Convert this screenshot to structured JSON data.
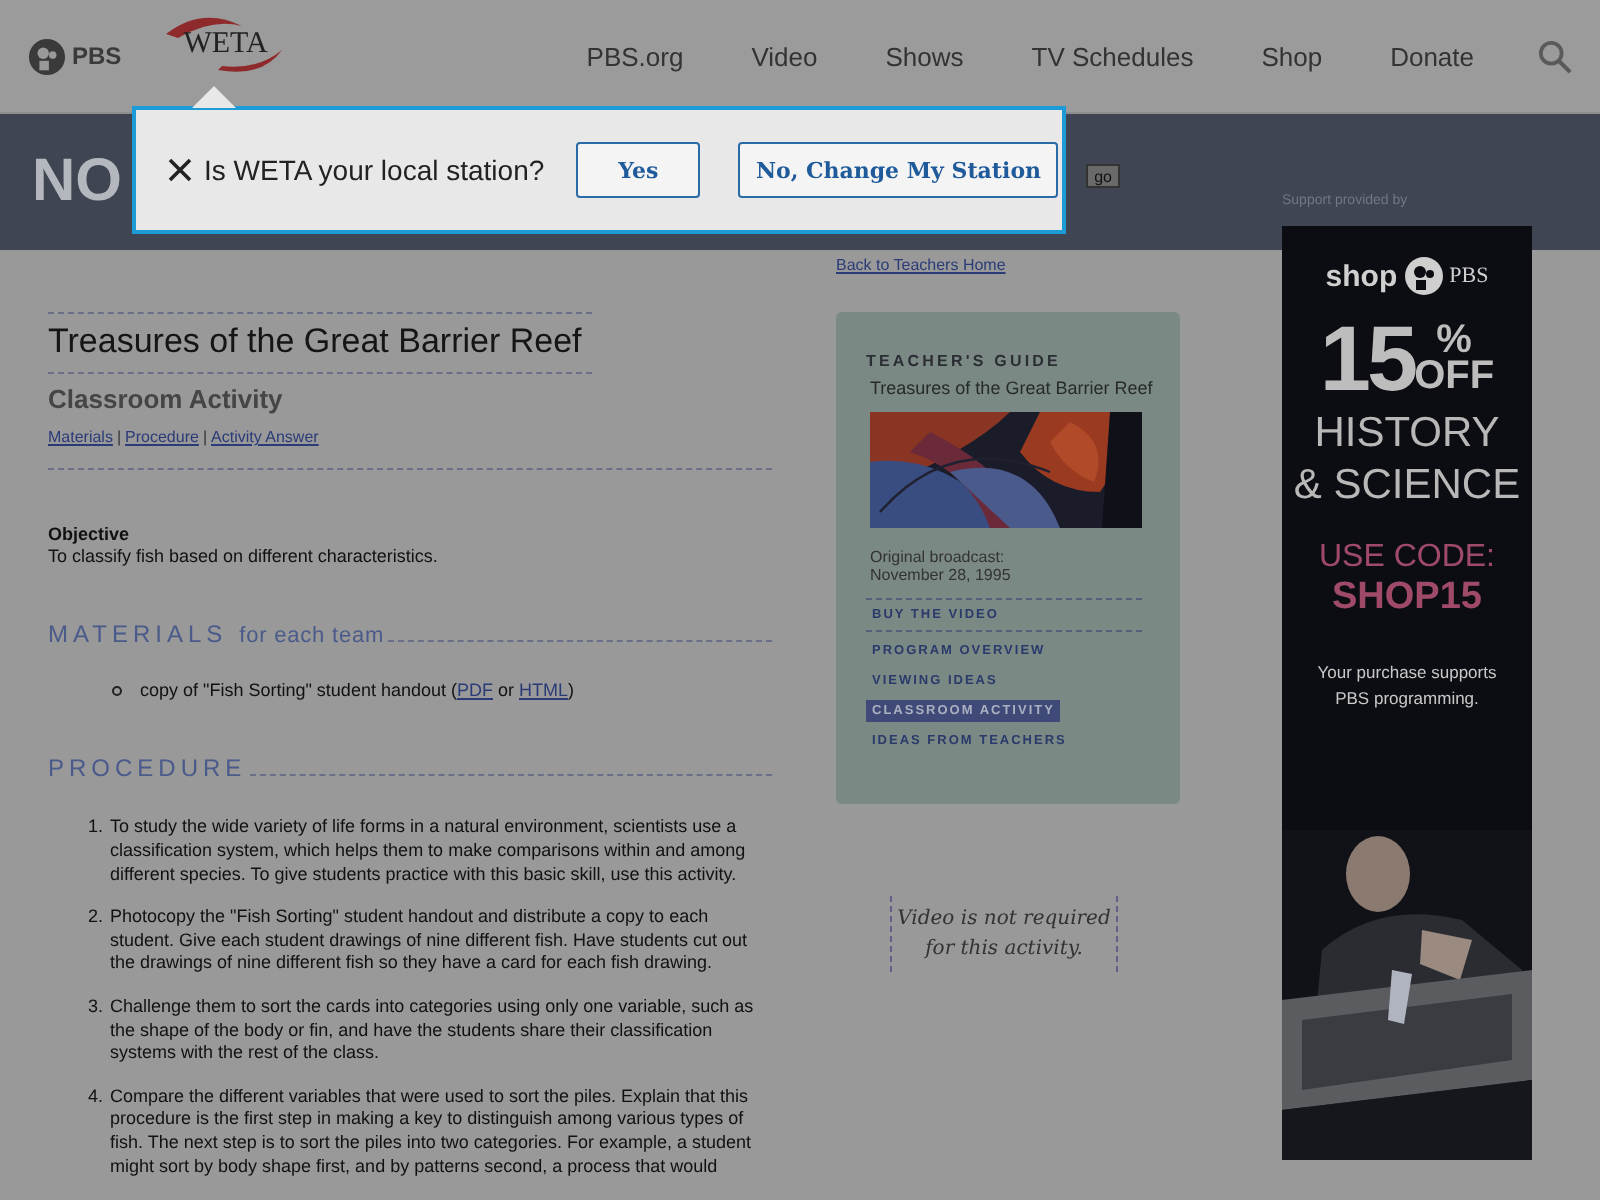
{
  "header": {
    "pbs_logo": "PBS",
    "station_logo": "WETA",
    "nav": [
      "PBS.org",
      "Video",
      "Shows",
      "TV Schedules",
      "Shop",
      "Donate"
    ]
  },
  "station_prompt": {
    "question": "Is WETA your local station?",
    "buttons": [
      "Yes",
      "No, Change My Station"
    ]
  },
  "banner": {
    "logo_main": "NO",
    "go_button": "go",
    "support_label": "Support provided by"
  },
  "article": {
    "title": "Treasures of the Great Barrier Reef",
    "subtitle": "Classroom Activity",
    "separator": "|",
    "links": [
      "Materials",
      "Procedure",
      "Activity Answer"
    ],
    "objective_label": "Objective",
    "objective_text": "To classify fish based on different characteristics.",
    "materials_heading": "MATERIALS",
    "materials_heading_sub": "for each team",
    "materials": [
      {
        "text": "copy of \"Fish Sorting\" student handout (",
        "links": [
          "PDF",
          "HTML"
        ],
        "joiner": "or",
        "close": ")"
      }
    ],
    "procedure_heading": "PROCEDURE",
    "steps": [
      {
        "number": "1.",
        "text": "To study the wide variety of life forms in a natural environment, scientists use a classification system, which helps them to make comparisons within and among different species. To give students practice with this basic skill, use this activity."
      },
      {
        "number": "2.",
        "text": "Photocopy the \"Fish Sorting\" student handout and distribute a copy to each student. Give each student drawings of nine different fish. Have students cut out the drawings of nine different fish so they have a card for each fish drawing."
      },
      {
        "number": "3.",
        "text": "Challenge them to sort the cards into categories using only one variable, such as the shape of the body or fin, and have the students share their classification systems with the rest of the class."
      },
      {
        "number": "4.",
        "text": "Compare the different variables that were used to sort the piles. Explain that this procedure is the first step in making a key to distinguish among various types of fish. The next step is to sort the piles into two categories. For example, a student might sort by body shape first, and by patterns second, a process that would"
      }
    ]
  },
  "sidebar": {
    "back_link": "Back to Teachers Home",
    "guide_heading": "TEACHER'S GUIDE",
    "guide_title": "Treasures of the Great Barrier Reef",
    "broadcast_label": "Original broadcast:",
    "broadcast_date": "November 28, 1995",
    "links": [
      {
        "label": "BUY THE VIDEO",
        "selected": false
      },
      {
        "label": "PROGRAM OVERVIEW",
        "selected": false
      },
      {
        "label": "VIEWING IDEAS",
        "selected": false
      },
      {
        "label": "CLASSROOM ACTIVITY",
        "selected": true
      },
      {
        "label": "IDEAS FROM TEACHERS",
        "selected": false
      }
    ],
    "note": "Video is not required for this activity."
  },
  "ad": {
    "brand_left": "shop",
    "brand_right": "PBS",
    "discount": "15",
    "percent": "%",
    "off": "OFF",
    "line1": "HISTORY",
    "line2": "& SCIENCE",
    "code_label": "USE CODE:",
    "code": "SHOP15",
    "tagline": "Your purchase supports PBS programming."
  }
}
